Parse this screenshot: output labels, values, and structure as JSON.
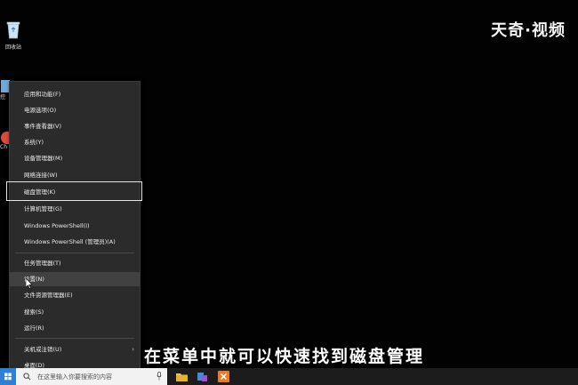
{
  "watermark": "天奇·视频",
  "desktop_icons": {
    "recycle_bin": "回收站",
    "partial_2": "控",
    "partial_3": "Ch"
  },
  "menu": {
    "items": [
      {
        "label": "应用和功能(F)"
      },
      {
        "label": "电源选项(O)"
      },
      {
        "label": "事件查看器(V)"
      },
      {
        "label": "系统(Y)"
      },
      {
        "label": "设备管理器(M)"
      },
      {
        "label": "网络连接(W)"
      },
      {
        "label": "磁盘管理(K)"
      },
      {
        "label": "计算机管理(G)"
      },
      {
        "label": "Windows PowerShell(I)"
      },
      {
        "label": "Windows PowerShell (管理员)(A)"
      },
      {
        "label": "任务管理器(T)"
      },
      {
        "label": "设置(N)"
      },
      {
        "label": "文件资源管理器(E)"
      },
      {
        "label": "搜索(S)"
      },
      {
        "label": "运行(R)"
      },
      {
        "label": "关机或注销(U)"
      },
      {
        "label": "桌面(D)"
      }
    ],
    "submenu_arrow": "›"
  },
  "subtitle": "在菜单中就可以快速找到磁盘管理",
  "taskbar": {
    "search_placeholder": "在这里输入你要搜索的内容"
  },
  "colors": {
    "start_blue": "#2e7fd6",
    "menu_bg": "#2b2b2b",
    "highlight_border": "#e6e6e6"
  }
}
